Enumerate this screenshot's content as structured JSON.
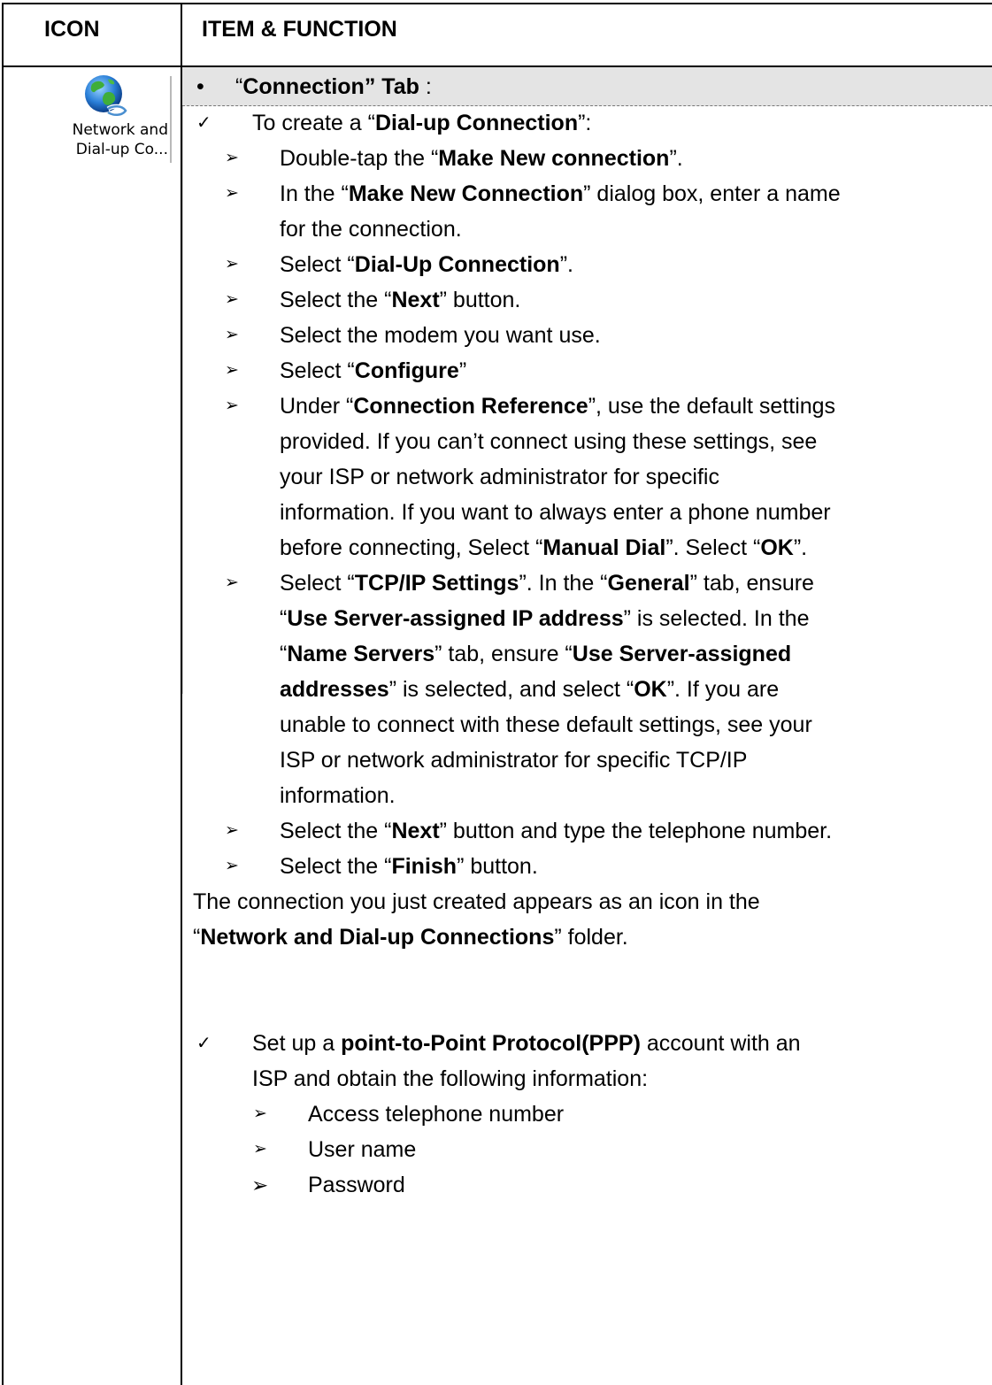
{
  "header": {
    "icon_col": "ICON",
    "item_col": "ITEM & FUNCTION"
  },
  "icon": {
    "name": "network-globe-icon",
    "label_line1": "Network and",
    "label_line2": "Dial-up Co..."
  },
  "tab": {
    "open_quote": "“",
    "name": "Connection",
    "close_text": "” Tab",
    "colon": " :"
  },
  "steps": {
    "create_intro": {
      "pre": "To create a “",
      "bold": "Dial-up Connection",
      "post": "”:"
    },
    "s1": {
      "pre": "Double-tap the “",
      "bold": "Make New connection",
      "post": "”."
    },
    "s2a": {
      "pre": "In the “",
      "bold": "Make New Connection",
      "post": "” dialog box, enter a name"
    },
    "s2b": "for the connection.",
    "s3": {
      "pre": "Select “",
      "bold": "Dial-Up Connection",
      "post": "”."
    },
    "s4": {
      "pre": "Select the “",
      "bold": "Next",
      "post": "” button."
    },
    "s5": "Select the modem you want use.",
    "s6": {
      "pre": "Select “",
      "bold": "Configure",
      "post": "”"
    },
    "s7a": {
      "pre": "Under “",
      "bold": "Connection Reference",
      "post": "”, use the default settings"
    },
    "s7b": "provided. If you can’t connect using these settings, see",
    "s7c": "your ISP or network administrator for specific",
    "s7d": "information. If you want to always enter a phone number",
    "s7e": {
      "pre": "before connecting, Select “",
      "bold": "Manual Dial",
      "mid": "”. Select “",
      "bold2": "OK",
      "post": "”."
    },
    "s8a": {
      "pre": "Select “",
      "bold": "TCP/IP Settings",
      "mid": "”. In the “",
      "bold2": "General",
      "post": "” tab, ensure"
    },
    "s8b": {
      "pre": "“",
      "bold": "Use Server-assigned IP address",
      "post": "” is selected. In the"
    },
    "s8c": {
      "pre": "“",
      "bold": "Name Servers",
      "mid": "” tab, ensure “",
      "bold2": "Use Server-assigned"
    },
    "s8d": {
      "bold": "addresses",
      "mid": "” is selected, and select “",
      "bold2": "OK",
      "post": "”. If you are"
    },
    "s8e": "unable to connect with these default settings, see your",
    "s8f": "ISP or network administrator for specific TCP/IP",
    "s8g": "information.",
    "s9": {
      "pre": "Select the “",
      "bold": "Next",
      "post": "” button and type the telephone number."
    },
    "s10": {
      "pre": "Select the “",
      "bold": "Finish",
      "post": "” button."
    },
    "result1": "The connection you just created appears as an icon in the",
    "result2": {
      "pre": "“",
      "bold": "Network and Dial-up Connections",
      "post": "” folder."
    },
    "ppp_a": {
      "pre": "Set up a ",
      "bold": "point-to-Point Protocol(PPP)",
      "post": " account with an"
    },
    "ppp_b": "ISP and obtain the following information:",
    "info1": "Access telephone number",
    "info2": "User name",
    "info3": "Password"
  },
  "glyphs": {
    "bullet": "•",
    "check": "✓",
    "arrow": "➢"
  }
}
